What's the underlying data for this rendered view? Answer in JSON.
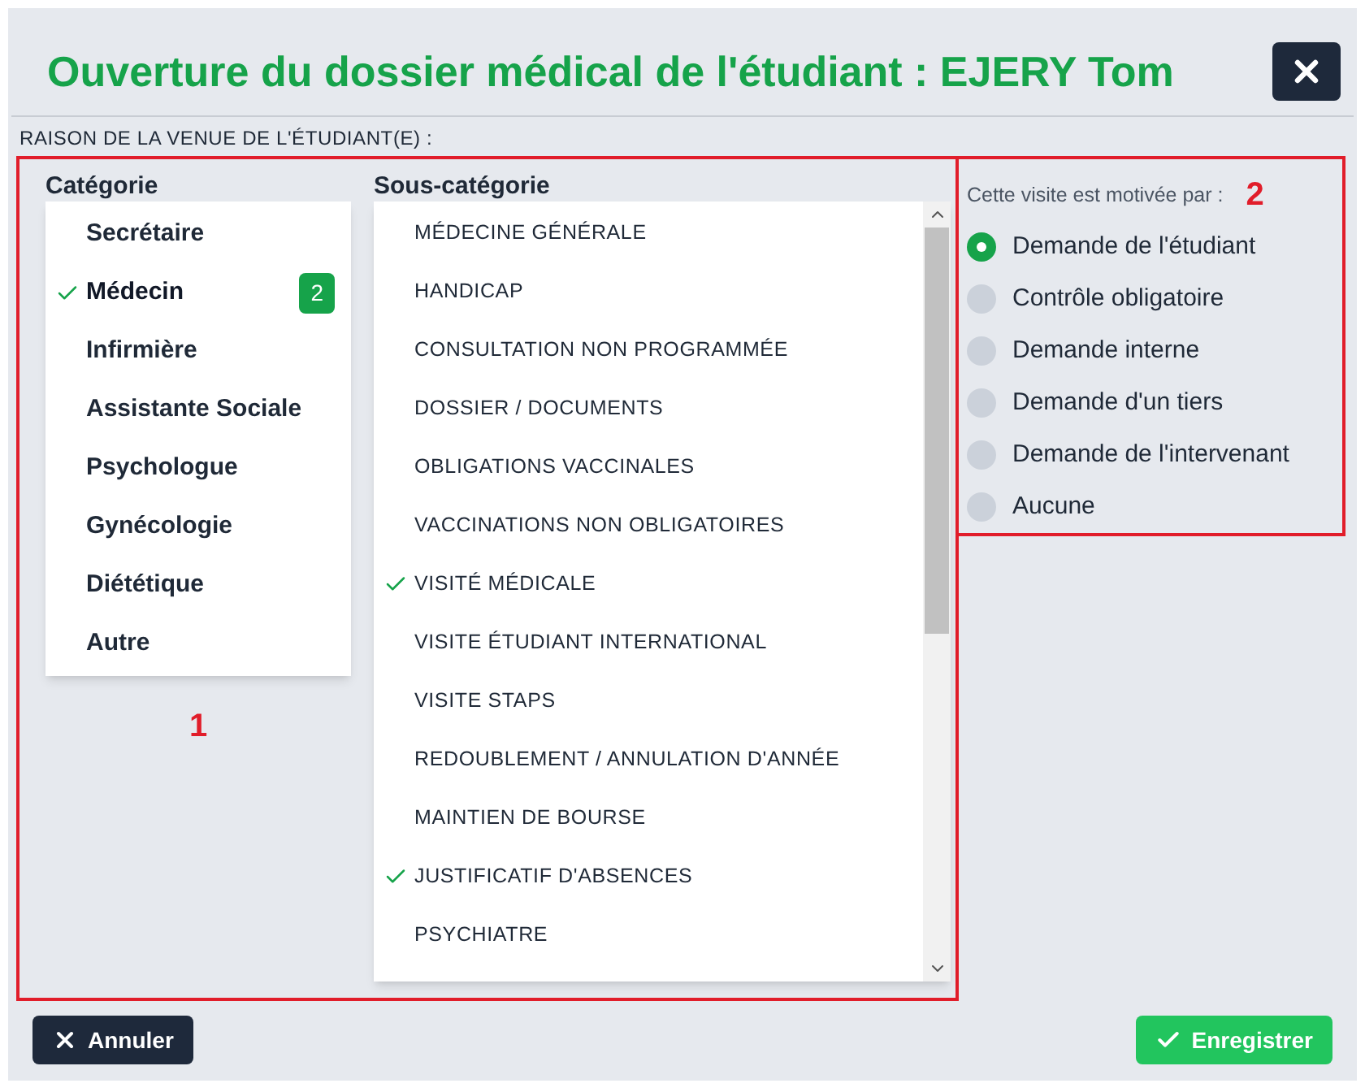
{
  "dialog": {
    "title": "Ouverture du dossier médical de l'étudiant : EJERY Tom"
  },
  "section_label": "RAISON DE LA VENUE DE L'ÉTUDIANT(E) :",
  "reason_panel": {
    "marker": "1",
    "category": {
      "heading": "Catégorie",
      "items": [
        {
          "label": "Secrétaire",
          "selected": false
        },
        {
          "label": "Médecin",
          "selected": true,
          "badge": "2"
        },
        {
          "label": "Infirmière",
          "selected": false
        },
        {
          "label": "Assistante Sociale",
          "selected": false
        },
        {
          "label": "Psychologue",
          "selected": false
        },
        {
          "label": "Gynécologie",
          "selected": false
        },
        {
          "label": "Diététique",
          "selected": false
        },
        {
          "label": "Autre",
          "selected": false
        }
      ]
    },
    "subcategory": {
      "heading": "Sous-catégorie",
      "items": [
        {
          "label": "MÉDECINE GÉNÉRALE",
          "selected": false
        },
        {
          "label": "HANDICAP",
          "selected": false
        },
        {
          "label": "CONSULTATION NON PROGRAMMÉE",
          "selected": false
        },
        {
          "label": "DOSSIER / DOCUMENTS",
          "selected": false
        },
        {
          "label": "OBLIGATIONS VACCINALES",
          "selected": false
        },
        {
          "label": "VACCINATIONS NON OBLIGATOIRES",
          "selected": false
        },
        {
          "label": "VISITÉ MÉDICALE",
          "selected": true
        },
        {
          "label": "VISITE ÉTUDIANT INTERNATIONAL",
          "selected": false
        },
        {
          "label": "VISITE STAPS",
          "selected": false
        },
        {
          "label": "REDOUBLEMENT / ANNULATION D'ANNÉE",
          "selected": false
        },
        {
          "label": "MAINTIEN DE BOURSE",
          "selected": false
        },
        {
          "label": "JUSTIFICATIF D'ABSENCES",
          "selected": true
        },
        {
          "label": "PSYCHIATRE",
          "selected": false
        }
      ]
    }
  },
  "motive_panel": {
    "marker": "2",
    "prompt": "Cette visite est motivée par :",
    "options": [
      {
        "label": "Demande de l'étudiant",
        "selected": true
      },
      {
        "label": "Contrôle obligatoire",
        "selected": false
      },
      {
        "label": "Demande interne",
        "selected": false
      },
      {
        "label": "Demande d'un tiers",
        "selected": false
      },
      {
        "label": "Demande de l'intervenant",
        "selected": false
      },
      {
        "label": "Aucune",
        "selected": false
      }
    ]
  },
  "buttons": [
    {
      "kind": "cancel",
      "label": "Annuler"
    },
    {
      "kind": "save",
      "label": "Enregistrer"
    }
  ]
}
